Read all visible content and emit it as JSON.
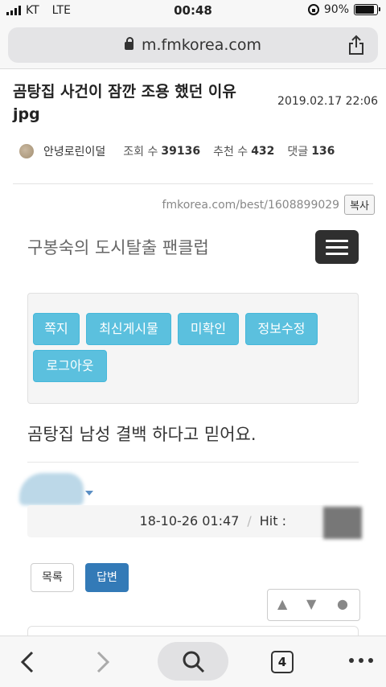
{
  "status": {
    "carrier": "KT",
    "network": "LTE",
    "time": "00:48",
    "battery": "90%",
    "battery_level": 0.9
  },
  "browser": {
    "url": "m.fmkorea.com",
    "tab_count": "4"
  },
  "post": {
    "title": "곰탕집 사건이 잠깐 조용 했던 이유 jpg",
    "date": "2019.02.17 22:06",
    "author": "안녕로린이덜",
    "views_label": "조회 수",
    "views": "39136",
    "likes_label": "추천 수",
    "likes": "432",
    "comments_label": "댓글",
    "comments": "136",
    "short_url": "fmkorea.com/best/1608899029",
    "copy_label": "복사"
  },
  "embed": {
    "site_name": "구봉숙의 도시탈출 팬클럽",
    "menu": [
      "쪽지",
      "최신게시물",
      "미확인",
      "정보수정",
      "로그아웃"
    ],
    "body": "곰탕집 남성 결백 하다고 믿어요.",
    "timestamp": "18-10-26 01:47",
    "hit_label": "Hit :",
    "list_button": "목록",
    "reply_button": "답변"
  },
  "colors": {
    "chip": "#5bc0de",
    "reply": "#337ab7",
    "burger": "#2f2f2f"
  }
}
